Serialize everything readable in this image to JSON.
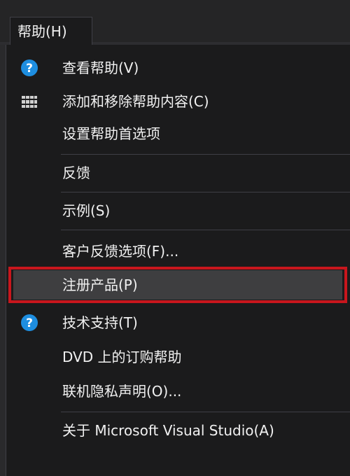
{
  "menubar": {
    "help_label": "帮助(H)"
  },
  "menu": {
    "items": [
      {
        "label": "查看帮助(V)",
        "icon": "help-circle-icon"
      },
      {
        "label": "添加和移除帮助内容(C)",
        "icon": "books-icon"
      },
      {
        "label": "设置帮助首选项"
      },
      {
        "label": "反馈"
      },
      {
        "label": "示例(S)"
      },
      {
        "label": "客户反馈选项(F)..."
      },
      {
        "label": "注册产品(P)"
      },
      {
        "label": "技术支持(T)",
        "icon": "help-circle-icon"
      },
      {
        "label": "DVD 上的订购帮助"
      },
      {
        "label": "联机隐私声明(O)..."
      },
      {
        "label": "关于 Microsoft Visual Studio(A)"
      }
    ]
  },
  "colors": {
    "menu_bg": "#1b1b1c",
    "text": "#f1f1f1",
    "separator": "#3f3f46",
    "highlight_border": "#c8161d",
    "help_icon": "#1e8ee0"
  }
}
